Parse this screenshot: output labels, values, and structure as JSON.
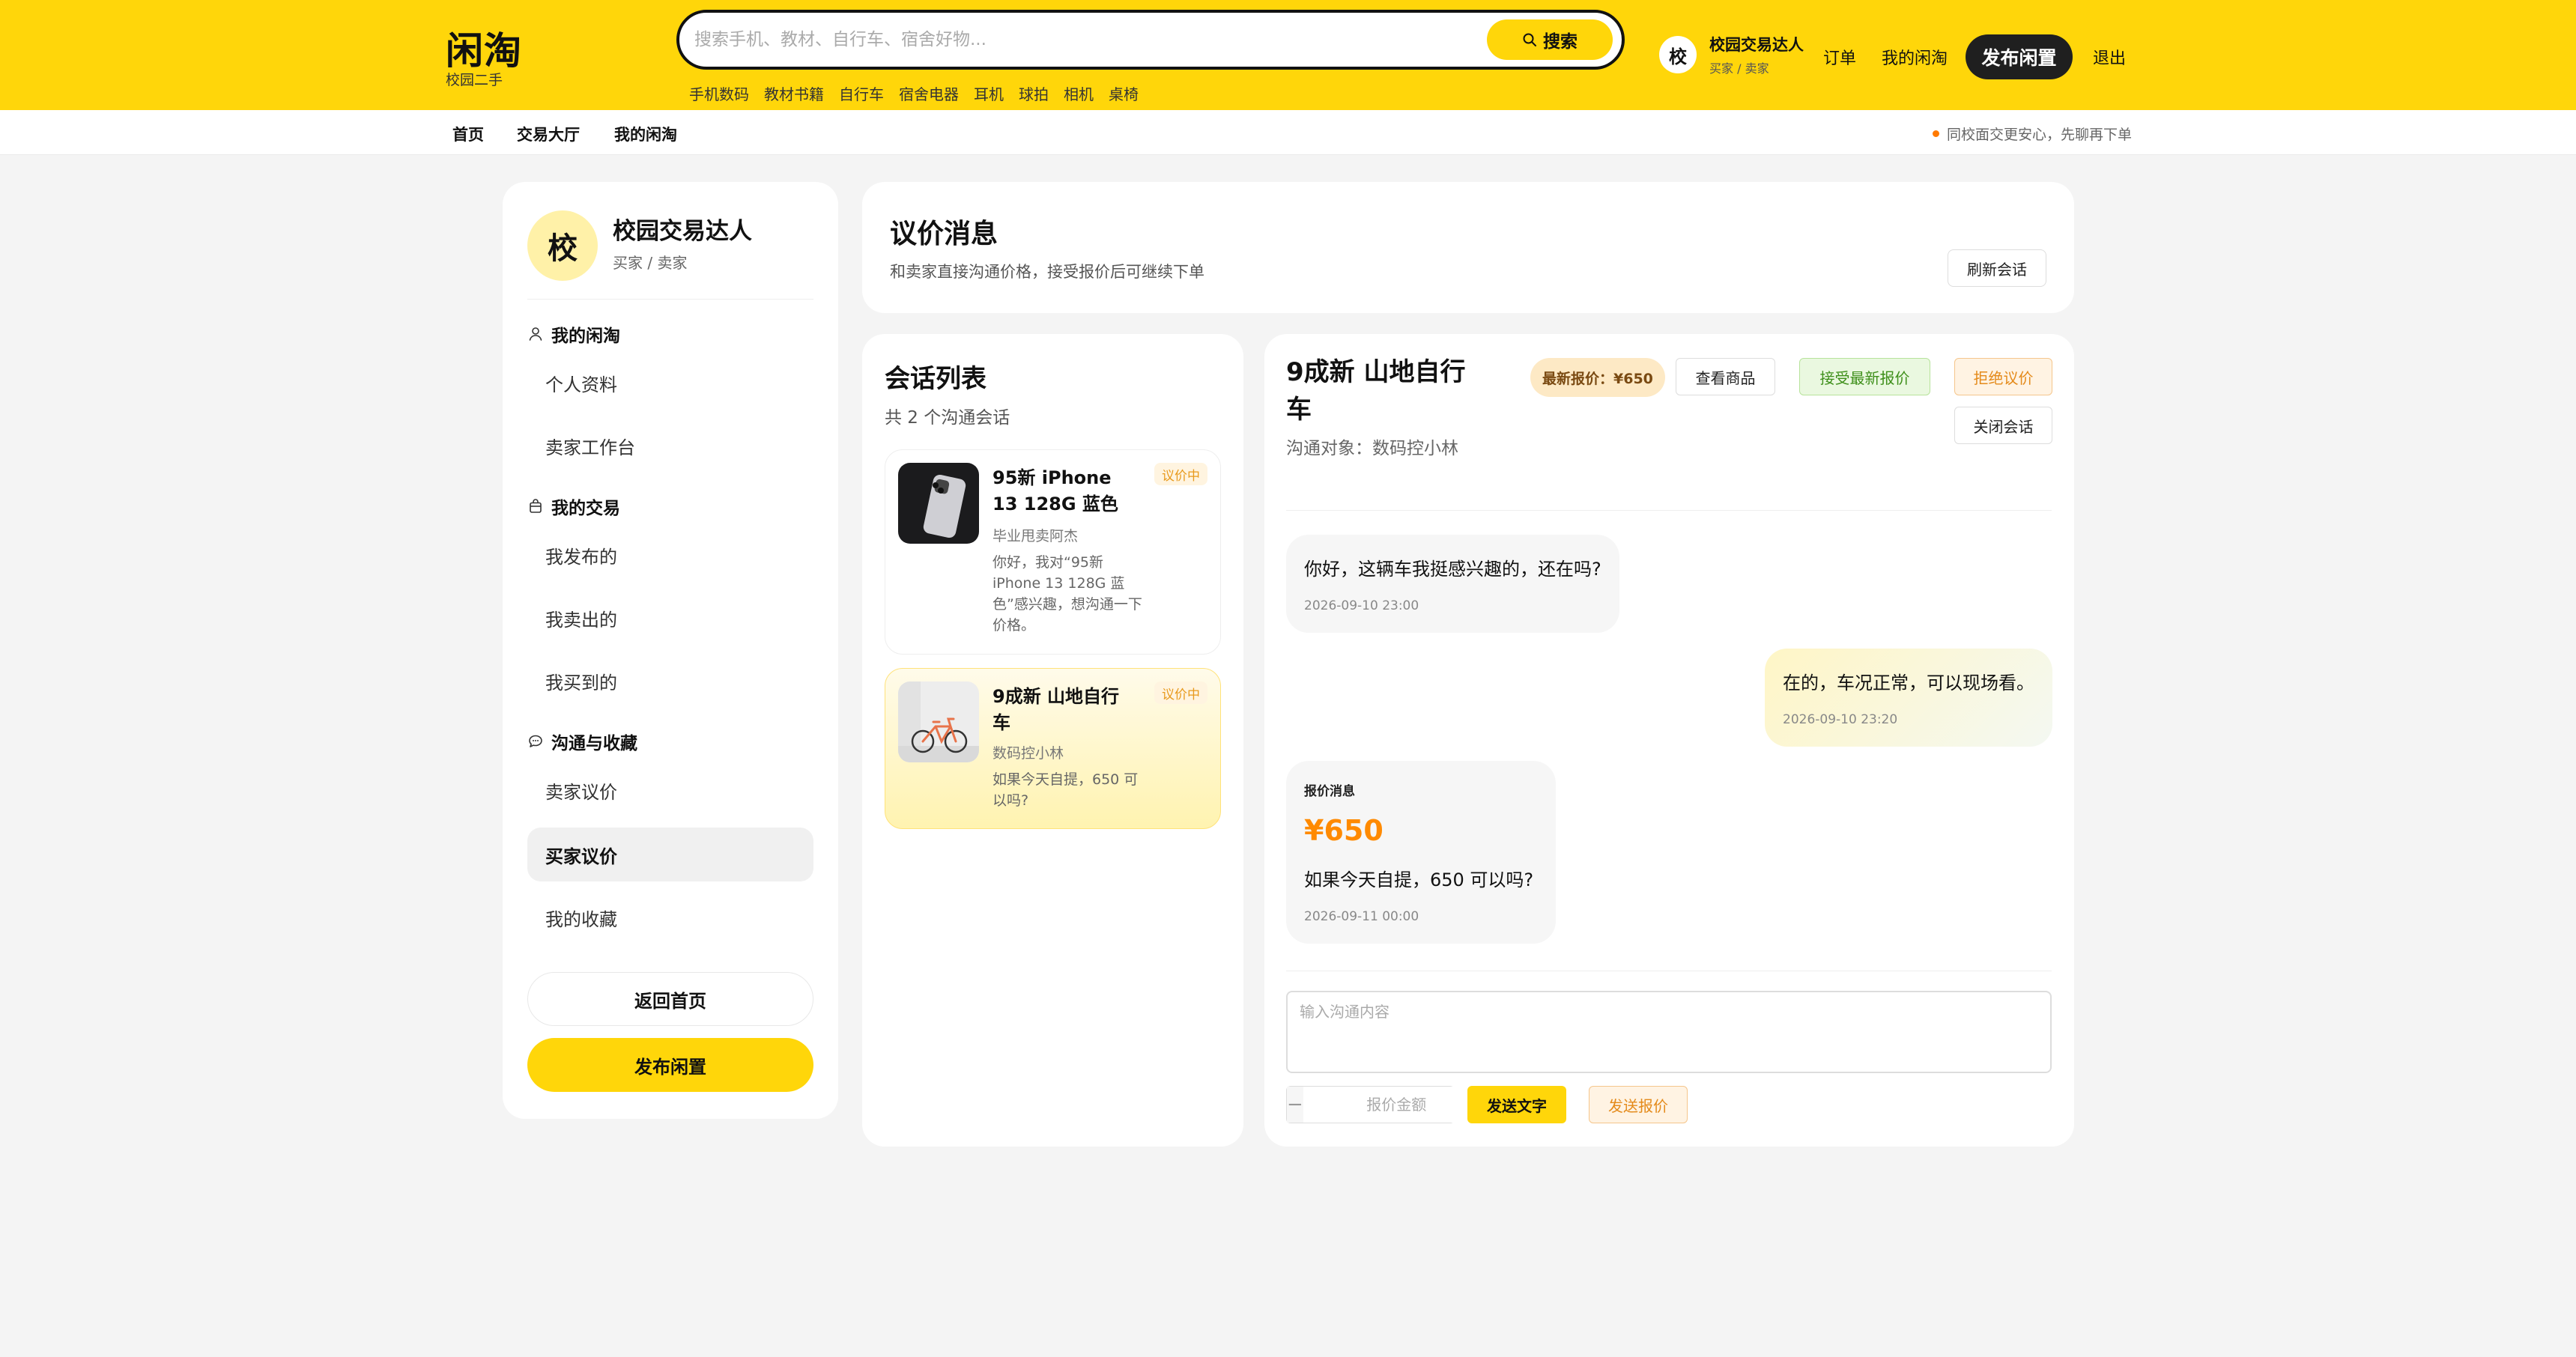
{
  "header": {
    "logo": "闲淘",
    "logo_sub": "校园二手",
    "search_placeholder": "搜索手机、教材、自行车、宿舍好物...",
    "search_button": "搜索",
    "hotwords": [
      "手机数码",
      "教材书籍",
      "自行车",
      "宿舍电器",
      "耳机",
      "球拍",
      "相机",
      "桌椅"
    ],
    "user_avatar": "校",
    "user_name": "校园交易达人",
    "user_role": "买家 / 卖家",
    "nav_orders": "订单",
    "nav_my": "我的闲淘",
    "publish": "发布闲置",
    "logout": "退出",
    "accent_color": "#ffd60a"
  },
  "subnav": {
    "items": [
      "首页",
      "交易大厅",
      "我的闲淘"
    ],
    "note": "同校面交更安心，先聊再下单"
  },
  "sidebar": {
    "avatar": "校",
    "name": "校园交易达人",
    "role": "买家 / 卖家",
    "groups": [
      {
        "title": "我的闲淘",
        "icon": "user-icon",
        "items": [
          "个人资料",
          "卖家工作台"
        ]
      },
      {
        "title": "我的交易",
        "icon": "bag-icon",
        "items": [
          "我发布的",
          "我卖出的",
          "我买到的"
        ]
      },
      {
        "title": "沟通与收藏",
        "icon": "chat-icon",
        "items": [
          "卖家议价",
          "买家议价",
          "我的收藏"
        ]
      }
    ],
    "active_item": "买家议价",
    "back_home": "返回首页",
    "publish": "发布闲置"
  },
  "page": {
    "title": "议价消息",
    "desc": "和卖家直接沟通价格，接受报价后可继续下单",
    "refresh": "刷新会话"
  },
  "conversations": {
    "title": "会话列表",
    "count": "共 2 个沟通会话",
    "items": [
      {
        "name": "95新 iPhone 13 128G 蓝色",
        "tag": "议价中",
        "seller": "毕业甩卖阿杰",
        "preview": "你好，我对“95新 iPhone 13 128G 蓝色”感兴趣，想沟通一下价格。"
      },
      {
        "name": "9成新 山地自行车",
        "tag": "议价中",
        "seller": "数码控小林",
        "preview": "如果今天自提，650 可以吗?"
      }
    ]
  },
  "chat": {
    "title": "9成新 山地自行车",
    "target": "沟通对象：数码控小林",
    "latest_price": "最新报价：¥650",
    "view_item": "查看商品",
    "accept": "接受最新报价",
    "reject": "拒绝议价",
    "close": "关闭会话",
    "messages": [
      {
        "side": "left",
        "text": "你好，这辆车我挺感兴趣的，还在吗?",
        "time": "2026-09-10 23:00"
      },
      {
        "side": "right",
        "text": "在的，车况正常，可以现场看。",
        "time": "2026-09-10 23:20"
      },
      {
        "side": "left",
        "type": "offer",
        "label": "报价消息",
        "price": "¥650",
        "text": "如果今天自提，650 可以吗?",
        "time": "2026-09-11 00:00"
      }
    ],
    "input_placeholder": "输入沟通内容",
    "price_placeholder": "报价金额",
    "minus": "−",
    "plus": "+",
    "send_text": "发送文字",
    "send_offer": "发送报价"
  }
}
